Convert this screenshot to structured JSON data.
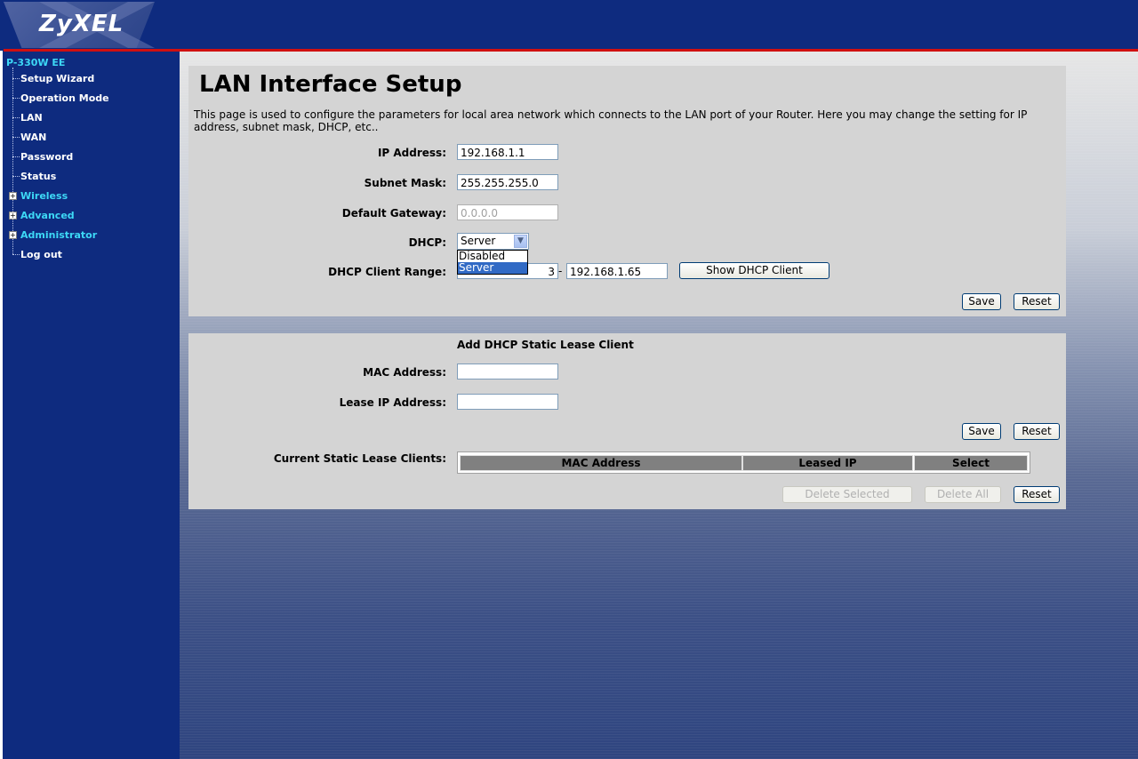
{
  "header": {
    "logo_text": "ZyXEL"
  },
  "sidebar": {
    "device_name": "P-330W EE",
    "items": [
      {
        "label": "Setup Wizard",
        "folder": false
      },
      {
        "label": "Operation Mode",
        "folder": false
      },
      {
        "label": "LAN",
        "folder": false
      },
      {
        "label": "WAN",
        "folder": false
      },
      {
        "label": "Password",
        "folder": false
      },
      {
        "label": "Status",
        "folder": false
      },
      {
        "label": "Wireless",
        "folder": true
      },
      {
        "label": "Advanced",
        "folder": true
      },
      {
        "label": "Administrator",
        "folder": true
      },
      {
        "label": "Log out",
        "folder": false
      }
    ]
  },
  "main": {
    "title": "LAN Interface Setup",
    "description": "This page is used to configure the parameters for local area network which connects to the LAN port of your Router. Here you may change the setting for IP address, subnet mask, DHCP, etc..",
    "ip_label": "IP Address:",
    "ip_value": "192.168.1.1",
    "subnet_label": "Subnet Mask:",
    "subnet_value": "255.255.255.0",
    "gateway_label": "Default Gateway:",
    "gateway_value": "0.0.0.0",
    "dhcp_label": "DHCP:",
    "dhcp_selected": "Server",
    "dhcp_options": [
      "Disabled",
      "Server"
    ],
    "range_label": "DHCP Client Range:",
    "range_start_visible": "3",
    "range_sep": "-",
    "range_end": "192.168.1.65",
    "show_dhcp_button": "Show DHCP Client",
    "save_button": "Save",
    "reset_button": "Reset"
  },
  "static_lease": {
    "title": "Add DHCP Static Lease Client",
    "mac_label": "MAC Address:",
    "mac_value": "",
    "lease_ip_label": "Lease IP Address:",
    "lease_ip_value": "",
    "save_button": "Save",
    "reset_button": "Reset",
    "current_label": "Current Static Lease Clients:",
    "table_headers": [
      "MAC Address",
      "Leased IP",
      "Select"
    ],
    "delete_selected_button": "Delete Selected",
    "delete_all_button": "Delete All",
    "reset2_button": "Reset"
  }
}
